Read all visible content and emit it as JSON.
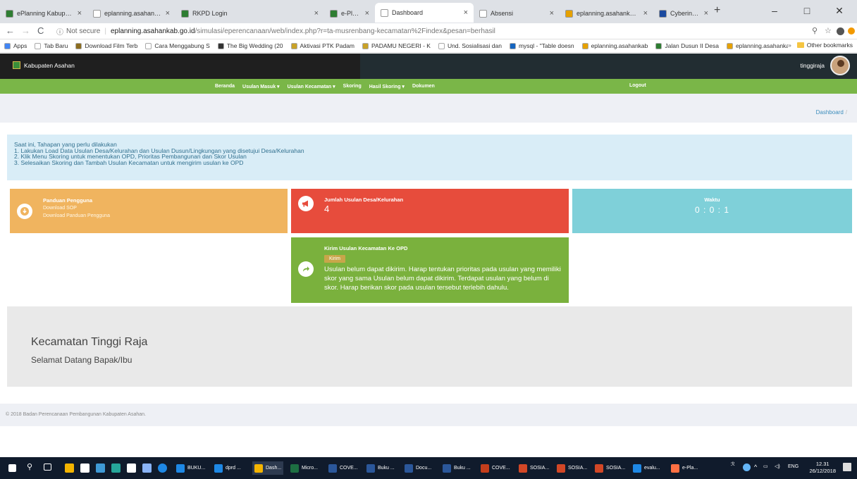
{
  "browser": {
    "tabs": [
      {
        "title": "ePlanning Kabupaten Asaha",
        "favicon": "#2e7d32",
        "active": false
      },
      {
        "title": "eplanning.asahankab.go.id",
        "favicon": "#ffffff",
        "active": false
      },
      {
        "title": "RKPD Login",
        "favicon": "#2e7d32",
        "active": false
      },
      {
        "title": "e-Planning Kabupaten Asah",
        "favicon": "#2e7d32",
        "active": false
      },
      {
        "title": "Dashboard",
        "favicon": "#ffffff",
        "active": true
      },
      {
        "title": "Absensi",
        "favicon": "#ffffff",
        "active": false
      },
      {
        "title": "eplanning.asahankab.go.id",
        "favicon": "#e6a100",
        "active": false
      },
      {
        "title": "Cyberindo Aditama | Speed",
        "favicon": "#1b4aa0",
        "active": false
      }
    ],
    "url": {
      "security": "Not secure",
      "host": "eplanning.asahankab.go.id",
      "path": "/simulasi/eperencanaan/web/index.php?r=ta-musrenbang-kecamatan%2Findex&pesan=berhasil"
    },
    "bookmarks": [
      {
        "label": "Apps",
        "color": "#4285f4"
      },
      {
        "label": "Tab Baru",
        "color": "#ffffff"
      },
      {
        "label": "Download Film Terb",
        "color": "#8c6d1f"
      },
      {
        "label": "Cara Menggabung S",
        "color": "#ffffff"
      },
      {
        "label": "The Big Wedding (20",
        "color": "#333333"
      },
      {
        "label": "Aktivasi PTK Padam",
        "color": "#c9a227"
      },
      {
        "label": "PADAMU NEGERI - K",
        "color": "#c9a227"
      },
      {
        "label": "Und. Sosialisasi dan",
        "color": "#ffffff"
      },
      {
        "label": "mysql - \"Table doesn",
        "color": "#1565c0"
      },
      {
        "label": "eplanning.asahankab",
        "color": "#e6a100"
      },
      {
        "label": "Jalan Dusun II Desa",
        "color": "#2e7d32"
      },
      {
        "label": "eplanning.asahankab",
        "color": "#e6a100"
      }
    ],
    "other_bookmarks": "Other bookmarks"
  },
  "site": {
    "brand": "Kabupaten Asahan",
    "user": "tinggiraja",
    "menu": [
      {
        "label": "Beranda",
        "dropdown": false
      },
      {
        "label": "Usulan Masuk",
        "dropdown": true
      },
      {
        "label": "Usulan Kecamatan",
        "dropdown": true
      },
      {
        "label": "Skoring",
        "dropdown": false
      },
      {
        "label": "Hasil Skoring",
        "dropdown": true
      },
      {
        "label": "Dokumen",
        "dropdown": false
      }
    ],
    "logout": "Logout",
    "breadcrumb": "Dashboard",
    "info": [
      "Saat ini, Tahapan yang perlu dilakukan",
      "1. Lakukan Load Data Usulan Desa/Kelurahan dan Usulan Dusun/Lingkungan yang disetujui Desa/Kelurahan",
      "2. Klik Menu Skoring untuk menentukan OPD, Prioritas Pembangunan dan Skor Usulan",
      "3. Selesaikan Skoring dan Tambah Usulan Kecamatan untuk mengirim usulan ke OPD"
    ],
    "panduan": {
      "title": "Panduan Pengguna",
      "link1": "Download SOP",
      "link2": "Download Panduan Pengguna"
    },
    "jumlah": {
      "title": "Jumlah Usulan Desa/Kelurahan",
      "value": "4"
    },
    "waktu": {
      "title": "Waktu",
      "value": "0 : 0 : 1"
    },
    "kirim": {
      "title": "Kirim Usulan Kecamatan Ke OPD",
      "button": "Kirim",
      "message": "Usulan belum dapat dikirim. Harap tentukan prioritas pada usulan yang memiliki skor yang sama Usulan belum dapat dikirim. Terdapat usulan yang belum di skor. Harap berikan skor pada usulan tersebut terlebih dahulu."
    },
    "welcome": {
      "heading": "Kecamatan Tinggi Raja",
      "sub": "Selamat Datang Bapak/Ibu"
    },
    "footer": "© 2018 Badan Perencanaan Pembangunan Kabupaten Asahan."
  },
  "taskbar": {
    "apps": [
      {
        "label": "BUKU...",
        "color": "#1e88e5"
      },
      {
        "label": "dprd ...",
        "color": "#1e88e5"
      },
      {
        "label": "Dash...",
        "color": "#f4b400"
      },
      {
        "label": "Micro...",
        "color": "#1d6f42"
      },
      {
        "label": "COVE...",
        "color": "#2b579a"
      },
      {
        "label": "Buku ...",
        "color": "#2b579a"
      },
      {
        "label": "Docu...",
        "color": "#2b579a"
      },
      {
        "label": "Buku ...",
        "color": "#2b579a"
      },
      {
        "label": "COVE...",
        "color": "#c43e1c"
      },
      {
        "label": "SOSIA...",
        "color": "#d24726"
      },
      {
        "label": "SOSIA...",
        "color": "#d24726"
      },
      {
        "label": "SOSIA...",
        "color": "#d24726"
      },
      {
        "label": "evalu...",
        "color": "#1e88e5"
      },
      {
        "label": "e-Pla...",
        "color": "#ff7043"
      }
    ],
    "lang": "ENG",
    "time": "12.31",
    "date": "26/12/2018"
  }
}
